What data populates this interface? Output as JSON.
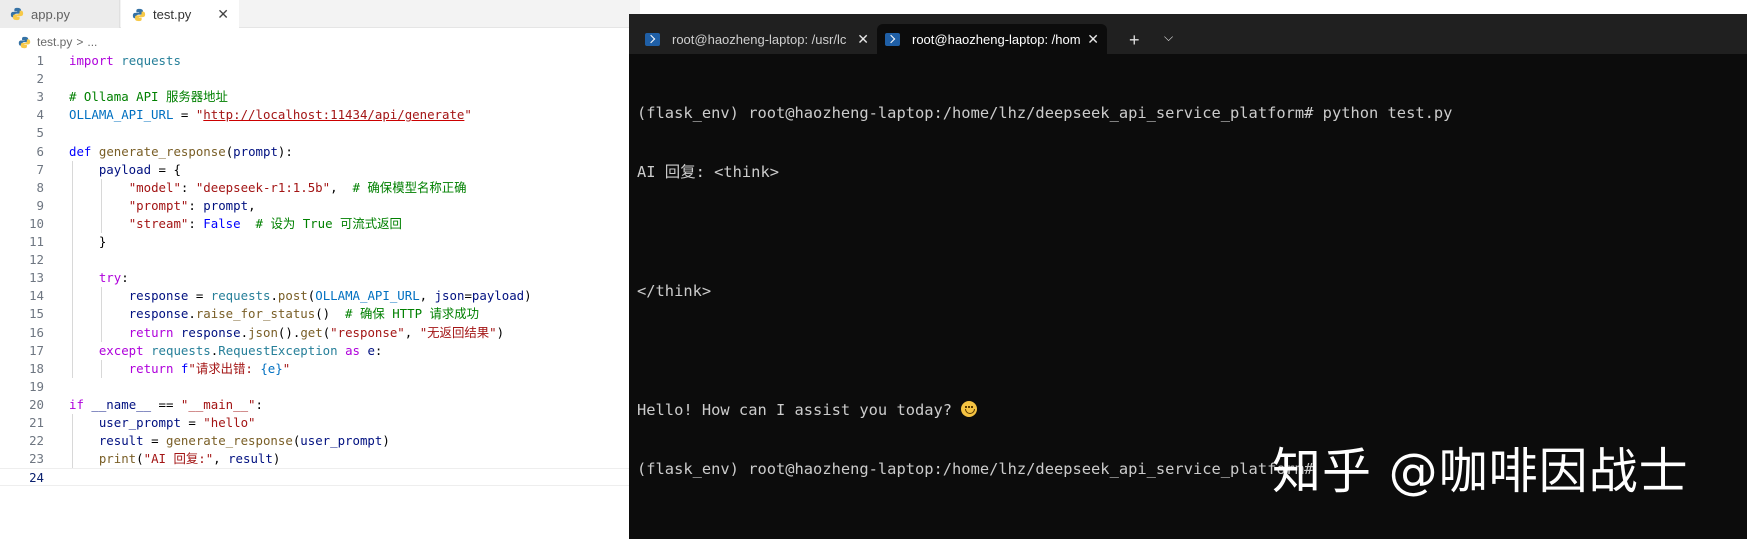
{
  "editor": {
    "tabs": [
      {
        "label": "app.py",
        "active": false
      },
      {
        "label": "test.py",
        "active": true
      }
    ],
    "close_glyph": "✕",
    "breadcrumb": {
      "file": "test.py",
      "separator": ">",
      "rest": "..."
    },
    "lines": [
      {
        "n": "1",
        "tokens": [
          [
            "kc",
            "import"
          ],
          [
            "txt",
            " "
          ],
          [
            "cls",
            "requests"
          ]
        ]
      },
      {
        "n": "2",
        "tokens": []
      },
      {
        "n": "3",
        "tokens": [
          [
            "cmt",
            "# Ollama API 服务器地址"
          ]
        ]
      },
      {
        "n": "4",
        "tokens": [
          [
            "const",
            "OLLAMA_API_URL"
          ],
          [
            "txt",
            " = "
          ],
          [
            "str",
            "\""
          ],
          [
            "url",
            "http://localhost:11434/api/generate"
          ],
          [
            "str",
            "\""
          ]
        ]
      },
      {
        "n": "5",
        "tokens": []
      },
      {
        "n": "6",
        "tokens": [
          [
            "kw",
            "def"
          ],
          [
            "txt",
            " "
          ],
          [
            "fn",
            "generate_response"
          ],
          [
            "txt",
            "("
          ],
          [
            "var",
            "prompt"
          ],
          [
            "txt",
            "):"
          ]
        ]
      },
      {
        "n": "7",
        "tokens": [
          [
            "txt",
            "    "
          ],
          [
            "var",
            "payload"
          ],
          [
            "txt",
            " = {"
          ]
        ]
      },
      {
        "n": "8",
        "tokens": [
          [
            "txt",
            "        "
          ],
          [
            "str",
            "\"model\""
          ],
          [
            "txt",
            ": "
          ],
          [
            "str",
            "\"deepseek-r1:1.5b\""
          ],
          [
            "txt",
            ",  "
          ],
          [
            "cmt",
            "# 确保模型名称正确"
          ]
        ]
      },
      {
        "n": "9",
        "tokens": [
          [
            "txt",
            "        "
          ],
          [
            "str",
            "\"prompt\""
          ],
          [
            "txt",
            ": "
          ],
          [
            "var",
            "prompt"
          ],
          [
            "txt",
            ","
          ]
        ]
      },
      {
        "n": "10",
        "tokens": [
          [
            "txt",
            "        "
          ],
          [
            "str",
            "\"stream\""
          ],
          [
            "txt",
            ": "
          ],
          [
            "kw",
            "False"
          ],
          [
            "txt",
            "  "
          ],
          [
            "cmt",
            "# 设为 True 可流式返回"
          ]
        ]
      },
      {
        "n": "11",
        "tokens": [
          [
            "txt",
            "    }"
          ]
        ]
      },
      {
        "n": "12",
        "tokens": []
      },
      {
        "n": "13",
        "tokens": [
          [
            "txt",
            "    "
          ],
          [
            "kc",
            "try"
          ],
          [
            "txt",
            ":"
          ]
        ]
      },
      {
        "n": "14",
        "tokens": [
          [
            "txt",
            "        "
          ],
          [
            "var",
            "response"
          ],
          [
            "txt",
            " = "
          ],
          [
            "cls",
            "requests"
          ],
          [
            "txt",
            "."
          ],
          [
            "fn",
            "post"
          ],
          [
            "txt",
            "("
          ],
          [
            "const",
            "OLLAMA_API_URL"
          ],
          [
            "txt",
            ", "
          ],
          [
            "var",
            "json"
          ],
          [
            "txt",
            "="
          ],
          [
            "var",
            "payload"
          ],
          [
            "txt",
            ")"
          ]
        ]
      },
      {
        "n": "15",
        "tokens": [
          [
            "txt",
            "        "
          ],
          [
            "var",
            "response"
          ],
          [
            "txt",
            "."
          ],
          [
            "fn",
            "raise_for_status"
          ],
          [
            "txt",
            "()  "
          ],
          [
            "cmt",
            "# 确保 HTTP 请求成功"
          ]
        ]
      },
      {
        "n": "16",
        "tokens": [
          [
            "txt",
            "        "
          ],
          [
            "kc",
            "return"
          ],
          [
            "txt",
            " "
          ],
          [
            "var",
            "response"
          ],
          [
            "txt",
            "."
          ],
          [
            "fn",
            "json"
          ],
          [
            "txt",
            "()."
          ],
          [
            "fn",
            "get"
          ],
          [
            "txt",
            "("
          ],
          [
            "str",
            "\"response\""
          ],
          [
            "txt",
            ", "
          ],
          [
            "str",
            "\"无返回结果\""
          ],
          [
            "txt",
            ")"
          ]
        ]
      },
      {
        "n": "17",
        "tokens": [
          [
            "txt",
            "    "
          ],
          [
            "kc",
            "except"
          ],
          [
            "txt",
            " "
          ],
          [
            "cls",
            "requests"
          ],
          [
            "txt",
            "."
          ],
          [
            "cls",
            "RequestException"
          ],
          [
            "txt",
            " "
          ],
          [
            "kc",
            "as"
          ],
          [
            "txt",
            " "
          ],
          [
            "var",
            "e"
          ],
          [
            "txt",
            ":"
          ]
        ]
      },
      {
        "n": "18",
        "tokens": [
          [
            "txt",
            "        "
          ],
          [
            "kc",
            "return"
          ],
          [
            "txt",
            " "
          ],
          [
            "kw",
            "f"
          ],
          [
            "str",
            "\"请求出错: "
          ],
          [
            "const",
            "{e}"
          ],
          [
            "str",
            "\""
          ]
        ]
      },
      {
        "n": "19",
        "tokens": []
      },
      {
        "n": "20",
        "tokens": [
          [
            "kc",
            "if"
          ],
          [
            "txt",
            " "
          ],
          [
            "var",
            "__name__"
          ],
          [
            "txt",
            " == "
          ],
          [
            "str",
            "\"__main__\""
          ],
          [
            "txt",
            ":"
          ]
        ]
      },
      {
        "n": "21",
        "tokens": [
          [
            "txt",
            "    "
          ],
          [
            "var",
            "user_prompt"
          ],
          [
            "txt",
            " = "
          ],
          [
            "str",
            "\"hello\""
          ]
        ]
      },
      {
        "n": "22",
        "tokens": [
          [
            "txt",
            "    "
          ],
          [
            "var",
            "result"
          ],
          [
            "txt",
            " = "
          ],
          [
            "fn",
            "generate_response"
          ],
          [
            "txt",
            "("
          ],
          [
            "var",
            "user_prompt"
          ],
          [
            "txt",
            ")"
          ]
        ]
      },
      {
        "n": "23",
        "tokens": [
          [
            "txt",
            "    "
          ],
          [
            "fn",
            "print"
          ],
          [
            "txt",
            "("
          ],
          [
            "str",
            "\"AI 回复:\""
          ],
          [
            "txt",
            ", "
          ],
          [
            "var",
            "result"
          ],
          [
            "txt",
            ")"
          ]
        ]
      },
      {
        "n": "24",
        "tokens": [],
        "active": true
      }
    ]
  },
  "terminal": {
    "tabs": [
      {
        "label": "root@haozheng-laptop: /usr/lc",
        "active": false
      },
      {
        "label": "root@haozheng-laptop: /hom",
        "active": true
      }
    ],
    "new_tab_glyph": "+",
    "dropdown_glyph": "⌵",
    "close_glyph": "✕",
    "output": [
      "(flask_env) root@haozheng-laptop:/home/lhz/deepseek_api_service_platform# python test.py",
      "AI 回复: <think>",
      "",
      "</think>",
      "",
      "Hello! How can I assist you today?",
      "(flask_env) root@haozheng-laptop:/home/lhz/deepseek_api_service_platform#"
    ],
    "emoji": "smiling-face-emoji"
  },
  "watermark": "知乎 @咖啡因战士",
  "colors": {
    "terminal_bg": "#0c0c0c",
    "terminal_tabbar": "#202020",
    "keyword": "#0000ff",
    "control": "#af00db",
    "function": "#795e26",
    "string": "#a31515",
    "comment": "#008000"
  }
}
